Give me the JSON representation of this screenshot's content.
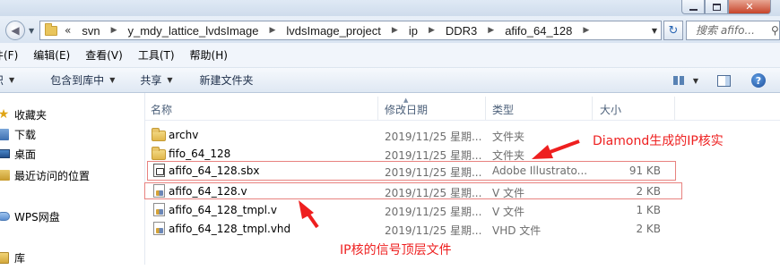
{
  "window": {
    "title_controls": {
      "minimize": "minimize",
      "maximize": "maximize",
      "close": "close"
    }
  },
  "address": {
    "overflow": "«",
    "crumbs": [
      "svn",
      "y_mdy_lattice_lvdsImage",
      "lvdsImage_project",
      "ip",
      "DDR3",
      "afifo_64_128"
    ],
    "search_placeholder": "搜索 afifo..."
  },
  "menu": {
    "items": [
      "件(F)",
      "编辑(E)",
      "查看(V)",
      "工具(T)",
      "帮助(H)"
    ]
  },
  "toolbar": {
    "organize": "织",
    "include_library": "包含到库中",
    "share": "共享",
    "new_folder": "新建文件夹"
  },
  "nav_pane": {
    "items": [
      {
        "label": "收藏夹",
        "icon": "star-icon"
      },
      {
        "label": "下载",
        "icon": "download-folder-icon"
      },
      {
        "label": "桌面",
        "icon": "desktop-icon"
      },
      {
        "label": "最近访问的位置",
        "icon": "recent-places-icon"
      },
      {
        "label": "WPS网盘",
        "icon": "cloud-drive-icon"
      },
      {
        "label": "库",
        "icon": "library-icon"
      }
    ]
  },
  "columns": {
    "name": "名称",
    "date": "修改日期",
    "type": "类型",
    "size": "大小"
  },
  "files": [
    {
      "name": "archv",
      "date": "2019/11/25 星期...",
      "type": "文件夹",
      "size": "",
      "icon": "folder-icon"
    },
    {
      "name": "fifo_64_128",
      "date": "2019/11/25 星期...",
      "type": "文件夹",
      "size": "",
      "icon": "folder-icon"
    },
    {
      "name": "afifo_64_128.sbx",
      "date": "2019/11/25 星期...",
      "type": "Adobe Illustrato...",
      "size": "91 KB",
      "icon": "sbx-file-icon"
    },
    {
      "name": "afifo_64_128.v",
      "date": "2019/11/25 星期...",
      "type": "V 文件",
      "size": "2 KB",
      "icon": "v-file-icon"
    },
    {
      "name": "afifo_64_128_tmpl.v",
      "date": "2019/11/25 星期...",
      "type": "V 文件",
      "size": "1 KB",
      "icon": "v-file-icon"
    },
    {
      "name": "afifo_64_128_tmpl.vhd",
      "date": "2019/11/25 星期...",
      "type": "VHD 文件",
      "size": "2 KB",
      "icon": "vhd-file-icon"
    }
  ],
  "annotations": {
    "diamond_ip": "Diamond生成的IP核实",
    "ip_top_file": "IP核的信号顶层文件",
    "color": "#ee1f1f"
  }
}
